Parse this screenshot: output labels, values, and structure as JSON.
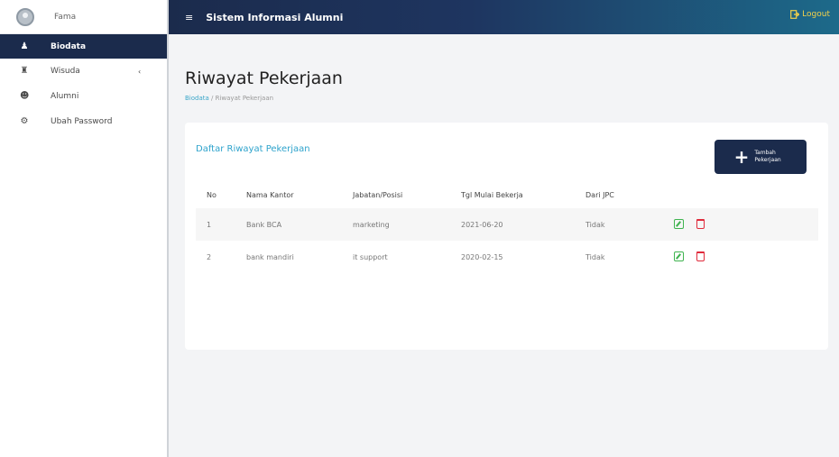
{
  "sidebar": {
    "user_name": "Fama",
    "items": [
      {
        "label": "Biodata",
        "icon": "user-icon",
        "active": true
      },
      {
        "label": "Wisuda",
        "icon": "graduate-icon",
        "caret": "‹"
      },
      {
        "label": "Alumni",
        "icon": "users-icon"
      },
      {
        "label": "Ubah Password",
        "icon": "gear-icon"
      }
    ]
  },
  "topbar": {
    "menu_icon": "≡",
    "title": "Sistem Informasi Alumni",
    "logout_label": "Logout"
  },
  "page": {
    "title": "Riwayat Pekerjaan",
    "breadcrumb_link": "Biodata",
    "breadcrumb_sep": " / ",
    "breadcrumb_current": "Riwayat Pekerjaan"
  },
  "card": {
    "title": "Daftar Riwayat Pekerjaan",
    "add_button_icon": "+",
    "add_button_label": "Tambah Pekerjaan"
  },
  "table": {
    "headers": [
      "No",
      "Nama Kantor",
      "Jabatan/Posisi",
      "Tgl Mulai Bekerja",
      "Dari JPC"
    ],
    "rows": [
      {
        "no": "1",
        "kantor": "Bank BCA",
        "jabatan": "marketing",
        "tgl": "2021-06-20",
        "jpc": "Tidak"
      },
      {
        "no": "2",
        "kantor": "bank mandiri",
        "jabatan": "it support",
        "tgl": "2020-02-15",
        "jpc": "Tidak"
      }
    ]
  },
  "colors": {
    "navy": "#1b2b4c",
    "accent": "#2ea3cc",
    "edit": "#3fb34f",
    "delete": "#e02b3c",
    "logout": "#f2d14a"
  }
}
